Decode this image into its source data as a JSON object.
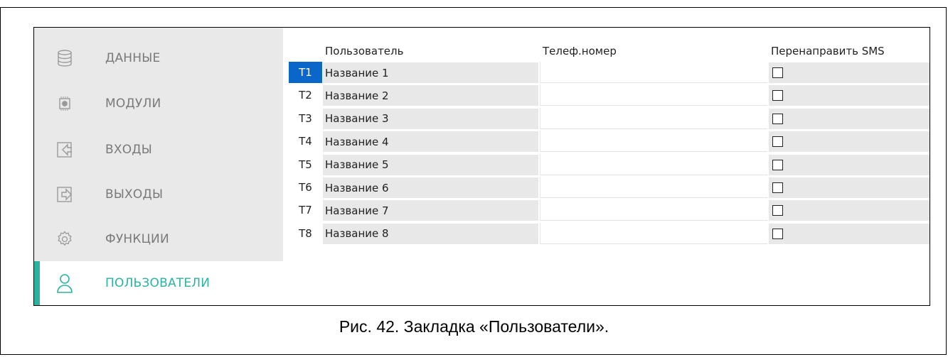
{
  "sidebar": {
    "items": [
      {
        "label": "ДАННЫЕ",
        "icon": "database-icon",
        "active": false
      },
      {
        "label": "МОДУЛИ",
        "icon": "chip-icon",
        "active": false
      },
      {
        "label": "ВХОДЫ",
        "icon": "input-icon",
        "active": false
      },
      {
        "label": "ВЫХОДЫ",
        "icon": "output-icon",
        "active": false
      },
      {
        "label": "ФУНКЦИИ",
        "icon": "gear-icon",
        "active": false
      },
      {
        "label": "ПОЛЬЗОВАТЕЛИ",
        "icon": "user-icon",
        "active": true
      }
    ],
    "accent_color": "#2bb3a0"
  },
  "table": {
    "headers": {
      "user": "Пользователь",
      "phone": "Телеф.номер",
      "sms": "Перенаправить SMS"
    },
    "rows": [
      {
        "num": "T1",
        "name": "Название 1",
        "phone": "",
        "sms": false,
        "selected": true
      },
      {
        "num": "T2",
        "name": "Название 2",
        "phone": "",
        "sms": false,
        "selected": false
      },
      {
        "num": "T3",
        "name": "Название 3",
        "phone": "",
        "sms": false,
        "selected": false
      },
      {
        "num": "T4",
        "name": "Название 4",
        "phone": "",
        "sms": false,
        "selected": false
      },
      {
        "num": "T5",
        "name": "Название 5",
        "phone": "",
        "sms": false,
        "selected": false
      },
      {
        "num": "T6",
        "name": "Название 6",
        "phone": "",
        "sms": false,
        "selected": false
      },
      {
        "num": "T7",
        "name": "Название 7",
        "phone": "",
        "sms": false,
        "selected": false
      },
      {
        "num": "T8",
        "name": "Название 8",
        "phone": "",
        "sms": false,
        "selected": false
      }
    ],
    "selection_color": "#0a66c9"
  },
  "caption": "Рис. 42. Закладка «Пользователи»."
}
